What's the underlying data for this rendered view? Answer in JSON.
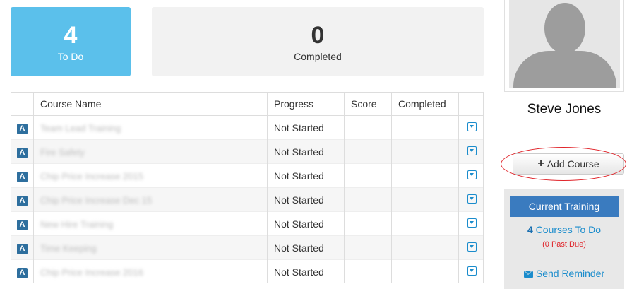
{
  "stats": {
    "todo": {
      "count": "4",
      "label": "To Do"
    },
    "completed": {
      "count": "0",
      "label": "Completed"
    }
  },
  "table": {
    "headers": [
      "",
      "Course Name",
      "Progress",
      "Score",
      "Completed",
      ""
    ],
    "rows": [
      {
        "badge": "A",
        "name": "Team Lead Training",
        "progress": "Not Started",
        "score": "",
        "completed": ""
      },
      {
        "badge": "A",
        "name": "Fire Safety",
        "progress": "Not Started",
        "score": "",
        "completed": ""
      },
      {
        "badge": "A",
        "name": "Chip Price Increase 2015",
        "progress": "Not Started",
        "score": "",
        "completed": ""
      },
      {
        "badge": "A",
        "name": "Chip Price Increase Dec 15",
        "progress": "Not Started",
        "score": "",
        "completed": ""
      },
      {
        "badge": "A",
        "name": "New Hire Training",
        "progress": "Not Started",
        "score": "",
        "completed": ""
      },
      {
        "badge": "A",
        "name": "Time Keeping",
        "progress": "Not Started",
        "score": "",
        "completed": ""
      },
      {
        "badge": "A",
        "name": "Chip Price Increase 2016",
        "progress": "Not Started",
        "score": "",
        "completed": ""
      }
    ]
  },
  "profile": {
    "name": "Steve Jones",
    "add_course_label": "Add Course"
  },
  "training": {
    "title": "Current Training",
    "courses_count": "4",
    "courses_label": "Courses To Do",
    "past_due": "(0 Past Due)",
    "send_reminder": "Send Reminder"
  },
  "colors": {
    "todo_tile": "#5bc0eb",
    "badge": "#2e6f9e",
    "training_header": "#3a7bbf",
    "link": "#1a8ccc",
    "highlight": "#e0242a"
  }
}
